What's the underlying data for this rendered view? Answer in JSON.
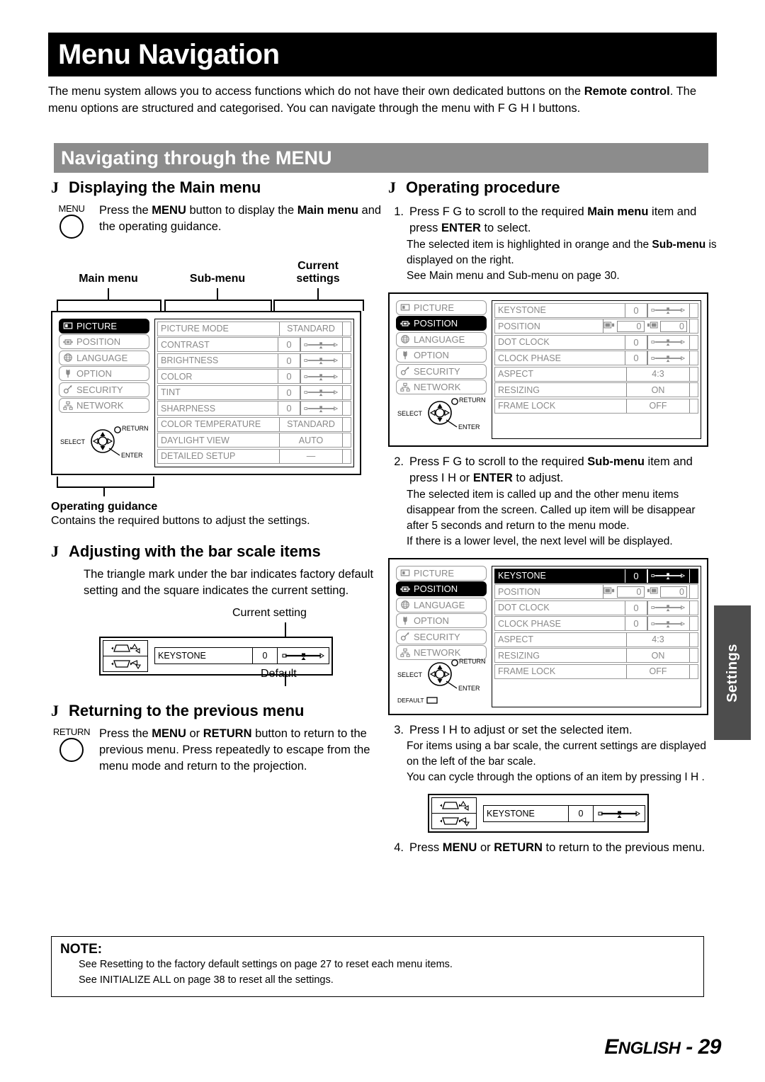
{
  "page": {
    "title": "Menu Navigation",
    "intro_parts": [
      {
        "t": "The menu system allows you to access functions which do not have their own dedicated buttons on the ",
        "b": false
      },
      {
        "t": "Remote control",
        "b": true
      },
      {
        "t": ". The menu options are structured and categorised. You can navigate through the menu with F  G  H  I  buttons.",
        "b": false
      }
    ],
    "section_bar": "Navigating through the MENU",
    "side_tab": "Settings",
    "footer_lang": "E",
    "footer_rest": "NGLISH",
    "footer_page": "- 29"
  },
  "note": {
    "title": "NOTE:",
    "lines": [
      "See  Resetting to the factory default settings  on page 27 to reset each menu items.",
      "See  INITIALIZE ALL  on page 38 to reset all the settings."
    ]
  },
  "left": {
    "heading_bullet": "J",
    "display_main_menu": {
      "heading": "Displaying the Main menu",
      "button_label": "MENU",
      "text_parts": [
        {
          "t": "Press the ",
          "b": false
        },
        {
          "t": "MENU",
          "b": true
        },
        {
          "t": " button to display the ",
          "b": false
        },
        {
          "t": "Main menu",
          "b": true
        },
        {
          "t": " and the operating guidance.",
          "b": false
        }
      ]
    },
    "brackets": {
      "main_menu": "Main menu",
      "sub_menu": "Sub-menu",
      "current_settings": "Current\nsettings"
    },
    "operating_guidance": {
      "label": "Operating guidance",
      "text": "Contains the required buttons to adjust the settings."
    },
    "bar_scale": {
      "heading": "Adjusting with the bar scale items",
      "text": "The triangle mark under the bar indicates factory default setting and the square indicates the current setting.",
      "callout_current": "Current setting",
      "callout_default": "Default"
    },
    "returning": {
      "heading": "Returning to the previous menu",
      "button_label": "RETURN",
      "text_parts": [
        {
          "t": "Press the ",
          "b": false
        },
        {
          "t": "MENU",
          "b": true
        },
        {
          "t": " or ",
          "b": false
        },
        {
          "t": "RETURN",
          "b": true
        },
        {
          "t": " button to return to the previous menu. Press repeatedly to escape from the menu mode and return to the projection.",
          "b": false
        }
      ]
    }
  },
  "right": {
    "heading": "Operating procedure",
    "steps": [
      {
        "n": "1.",
        "parts": [
          {
            "t": "Press F  G  to scroll to the required ",
            "b": false
          },
          {
            "t": "Main menu",
            "b": true
          },
          {
            "t": " item and press ",
            "b": false
          },
          {
            "t": "ENTER",
            "b": true
          },
          {
            "t": " to select.",
            "b": false
          }
        ],
        "subs": [
          [
            {
              "t": "The selected item is highlighted in orange and the ",
              "b": false
            },
            {
              "t": "Sub-menu",
              "b": true
            },
            {
              "t": " is displayed on the right.",
              "b": false
            }
          ],
          [
            {
              "t": "See  Main menu and Sub-menu  on page 30.",
              "b": false
            }
          ]
        ]
      },
      {
        "n": "2.",
        "parts": [
          {
            "t": "Press F  G  to scroll to the required ",
            "b": false
          },
          {
            "t": "Sub-menu",
            "b": true
          },
          {
            "t": " item and press I   H  or ",
            "b": false
          },
          {
            "t": "ENTER",
            "b": true
          },
          {
            "t": " to adjust.",
            "b": false
          }
        ],
        "subs": [
          [
            {
              "t": "The selected item is called up and the other menu items disappear from the screen. Called up item will be disappear after 5 seconds and return to the menu mode.",
              "b": false
            }
          ],
          [
            {
              "t": "If there is a lower level, the next level will be displayed.",
              "b": false
            }
          ]
        ]
      },
      {
        "n": "3.",
        "parts": [
          {
            "t": "Press I   H  to adjust or set the selected item.",
            "b": false
          }
        ],
        "subs": [
          [
            {
              "t": "For items using a bar scale, the current settings are displayed on the left of the bar scale.",
              "b": false
            }
          ],
          [
            {
              "t": "You can cycle through the options of an item by pressing I   H .",
              "b": false
            }
          ]
        ]
      },
      {
        "n": "4.",
        "parts": [
          {
            "t": "Press ",
            "b": false
          },
          {
            "t": "MENU",
            "b": true
          },
          {
            "t": " or ",
            "b": false
          },
          {
            "t": "RETURN",
            "b": true
          },
          {
            "t": " to return to the previous menu.",
            "b": false
          }
        ],
        "subs": []
      }
    ]
  },
  "osd": {
    "nav_labels": {
      "select": "SELECT",
      "return": "RETURN",
      "enter": "ENTER",
      "default": "DEFAULT"
    },
    "main_items": [
      {
        "label": "PICTURE",
        "icon": "picture-icon"
      },
      {
        "label": "POSITION",
        "icon": "position-icon"
      },
      {
        "label": "LANGUAGE",
        "icon": "globe-icon"
      },
      {
        "label": "OPTION",
        "icon": "plug-icon"
      },
      {
        "label": "SECURITY",
        "icon": "key-icon"
      },
      {
        "label": "NETWORK",
        "icon": "network-icon"
      }
    ],
    "picture_menu": {
      "selected_main": "PICTURE",
      "rows": [
        {
          "name": "PICTURE MODE",
          "value": "STANDARD",
          "kind": "value"
        },
        {
          "name": "CONTRAST",
          "value": "0",
          "kind": "bar"
        },
        {
          "name": "BRIGHTNESS",
          "value": "0",
          "kind": "bar"
        },
        {
          "name": "COLOR",
          "value": "0",
          "kind": "bar"
        },
        {
          "name": "TINT",
          "value": "0",
          "kind": "bar"
        },
        {
          "name": "SHARPNESS",
          "value": "0",
          "kind": "bar"
        },
        {
          "name": "COLOR TEMPERATURE",
          "value": "STANDARD",
          "kind": "value"
        },
        {
          "name": "DAYLIGHT VIEW",
          "value": "AUTO",
          "kind": "value"
        },
        {
          "name": "DETAILED SETUP",
          "value": "—",
          "kind": "value"
        }
      ]
    },
    "position_menu": {
      "selected_main": "POSITION",
      "rows": [
        {
          "name": "KEYSTONE",
          "value": "0",
          "kind": "bar"
        },
        {
          "name": "POSITION",
          "value": "0",
          "value2": "0",
          "kind": "position"
        },
        {
          "name": "DOT CLOCK",
          "value": "0",
          "kind": "bar"
        },
        {
          "name": "CLOCK PHASE",
          "value": "0",
          "kind": "bar"
        },
        {
          "name": "ASPECT",
          "value": "4:3",
          "kind": "value"
        },
        {
          "name": "RESIZING",
          "value": "ON",
          "kind": "value"
        },
        {
          "name": "FRAME LOCK",
          "value": "OFF",
          "kind": "value"
        }
      ]
    },
    "position_menu_selected": {
      "selected_main": "POSITION",
      "selected_row": "KEYSTONE",
      "rows": [
        {
          "name": "KEYSTONE",
          "value": "0",
          "kind": "bar"
        },
        {
          "name": "POSITION",
          "value": "0",
          "value2": "0",
          "kind": "position"
        },
        {
          "name": "DOT CLOCK",
          "value": "0",
          "kind": "bar"
        },
        {
          "name": "CLOCK PHASE",
          "value": "0",
          "kind": "bar"
        },
        {
          "name": "ASPECT",
          "value": "4:3",
          "kind": "value"
        },
        {
          "name": "RESIZING",
          "value": "ON",
          "kind": "value"
        },
        {
          "name": "FRAME LOCK",
          "value": "OFF",
          "kind": "value"
        }
      ]
    },
    "keystone_figure": {
      "name": "KEYSTONE",
      "value": "0"
    }
  }
}
